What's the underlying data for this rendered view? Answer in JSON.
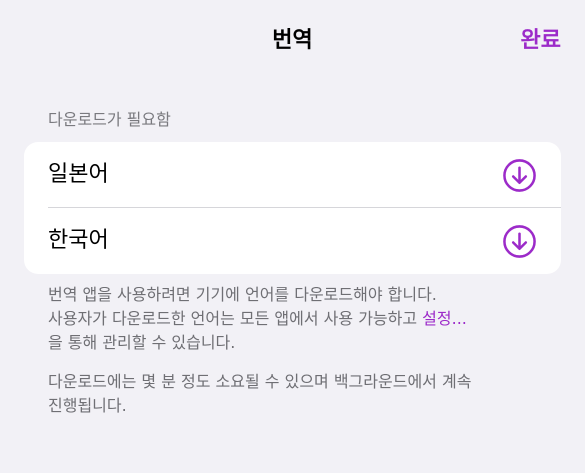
{
  "nav": {
    "title": "번역",
    "done_label": "완료"
  },
  "section": {
    "header": "다운로드가 필요함",
    "languages": [
      {
        "label": "일본어",
        "icon": "download-icon"
      },
      {
        "label": "한국어",
        "icon": "download-icon"
      }
    ]
  },
  "footer": {
    "line1": "번역 앱을 사용하려면 기기에 언어를 다운로드해야 합니다.",
    "line2_prefix": "사용자가 다운로드한 언어는 모든 앱에서 사용 가능하고 ",
    "settings_link": "설정...",
    "line3": "을 통해 관리할 수 있습니다.",
    "note_line1": "다운로드에는 몇 분 정도 소요될 수 있으며 백그라운드에서 계속",
    "note_line2": "진행됩니다."
  },
  "colors": {
    "accent": "#9c2bc9",
    "background": "#f2f1f6",
    "card": "#ffffff",
    "secondary_text": "#6f6f74"
  }
}
